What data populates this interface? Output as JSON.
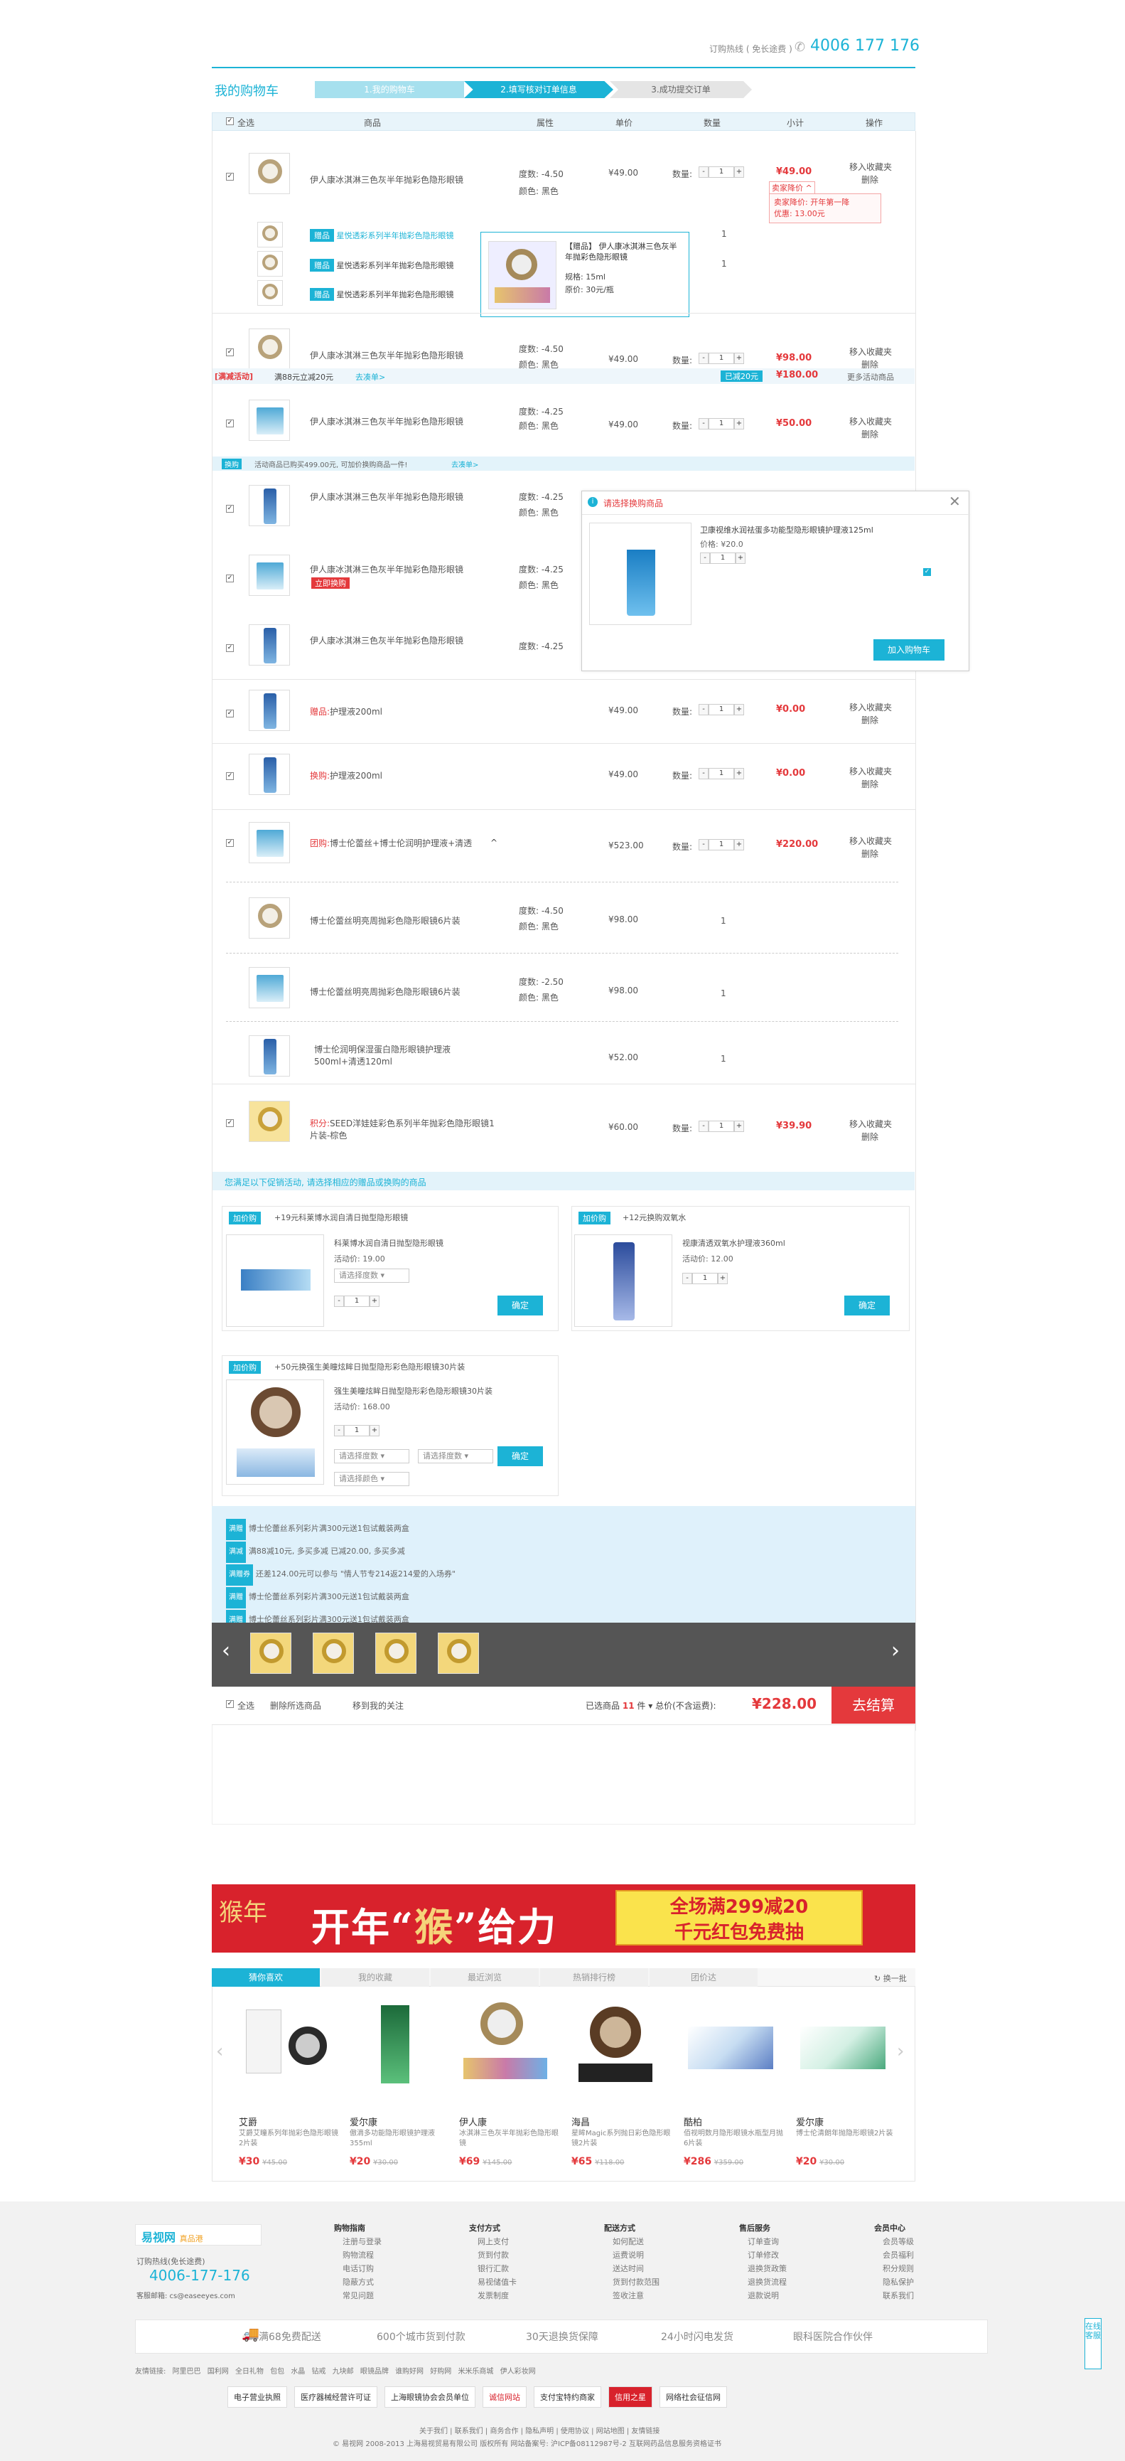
{
  "header": {
    "hotline_label": "订购热线 ( 免长途费 )",
    "hotline_number": "4006 177 176"
  },
  "steps": {
    "title": "我的购物车",
    "step1": "1.我的购物车",
    "step2": "2.填写核对订单信息",
    "step3": "3.成功提交订单"
  },
  "table_head": {
    "select_all": "全选",
    "product": "商品",
    "attr": "属性",
    "unit_price": "单价",
    "quantity": "数量",
    "subtotal": "小计",
    "action": "操作"
  },
  "common": {
    "qty_label": "数量:",
    "degree_prefix": "度数:",
    "color_label": "颜色: 黑色",
    "move_fav": "移入收藏夹",
    "delete": "删除",
    "product_name": "伊人康冰淇淋三色灰半年抛彩色隐形眼镜"
  },
  "row1": {
    "degree": "度数: -4.50",
    "price": "¥49.00",
    "qty": "1",
    "subtotal": "¥49.00",
    "price_drop": "卖家降价",
    "tip_line1": "卖家降价: 开年第一降",
    "tip_line2": "优惠: 13.00元"
  },
  "gifts": {
    "tag": "赠品",
    "name": "星悦透彩系列半年抛彩色隐形眼镜",
    "qty": "1",
    "count_x": "×"
  },
  "popup": {
    "title": "【赠品】 伊人康冰淇淋三色灰半年抛彩色隐形眼镜",
    "spec": "规格: 15ml",
    "orig": "原价: 30元/瓶"
  },
  "row2": {
    "degree": "度数: -4.50",
    "price": "¥49.00",
    "qty": "1",
    "subtotal": "¥98.00"
  },
  "promo_bar": {
    "tag": "[满减活动]",
    "text": "满88元立减20元",
    "link": "去凑单>",
    "saved": "已减20元",
    "total": "¥180.00",
    "more": "更多活动商品"
  },
  "row3": {
    "degree": "度数: -4.25",
    "price": "¥49.00",
    "qty": "1",
    "subtotal": "¥50.00"
  },
  "exchange_bar": {
    "tag": "换购",
    "text": "活动商品已购买499.00元, 可加价换购商品一件!",
    "link": "去凑单>"
  },
  "row4": {
    "degree": "度数: -4.25"
  },
  "row5": {
    "degree": "度数: -4.25",
    "badge": "立即换购"
  },
  "row6": {
    "degree": "度数: -4.25"
  },
  "swap_popup": {
    "title": "请选择换购商品",
    "name": "卫康视维水润祛蛋多功能型隐形眼镜护理液125ml",
    "price": "价格: ¥20.0",
    "qty": "1",
    "button": "加入购物车"
  },
  "row7": {
    "prefix": "赠品:",
    "name": "护理液200ml",
    "price": "¥49.00",
    "qty": "1",
    "subtotal": "¥0.00"
  },
  "row8": {
    "prefix": "换购:",
    "name": "护理液200ml",
    "price": "¥49.00",
    "qty": "1",
    "subtotal": "¥0.00"
  },
  "row9": {
    "prefix": "团购:",
    "name": "博士伦蕾丝+博士伦润明护理液+清透",
    "price": "¥523.00",
    "qty": "1",
    "subtotal": "¥220.00"
  },
  "bundle": [
    {
      "name": "博士伦蕾丝明亮周抛彩色隐形眼镜6片装",
      "degree": "度数: -4.50",
      "color": "颜色: 黑色",
      "price": "¥98.00",
      "qty": "1"
    },
    {
      "name": "博士伦蕾丝明亮周抛彩色隐形眼镜6片装",
      "degree": "度数: -2.50",
      "color": "颜色: 黑色",
      "price": "¥98.00",
      "qty": "1"
    },
    {
      "name": "博士伦润明保湿蛋白隐形眼镜护理液500ml+清透120ml",
      "degree": "",
      "color": "",
      "price": "¥52.00",
      "qty": "1"
    }
  ],
  "row10": {
    "prefix": "积分:",
    "name": "SEED洋娃娃彩色系列半年抛彩色隐形眼镜1片装-棕色",
    "price": "¥60.00",
    "qty": "1",
    "subtotal": "¥39.90"
  },
  "addon_title": "您满足以下促销活动, 请选择相应的赠品或换购的商品",
  "addon": [
    {
      "tag": "加价购",
      "title": "+19元科莱博水润自清日抛型隐形眼镜",
      "name": "科莱博水润自清日抛型隐形眼镜",
      "price": "活动价: 19.00",
      "select1": "请选择度数",
      "qty": "1",
      "btn": "确定"
    },
    {
      "tag": "加价购",
      "title": "+12元换购双氧水",
      "name": "视康清透双氧水护理液360ml",
      "price": "活动价: 12.00",
      "qty": "1",
      "btn": "确定"
    },
    {
      "tag": "加价购",
      "title": "+50元换强生美瞳炫眸日抛型隐形彩色隐形眼镜30片装",
      "name": "强生美瞳炫眸日抛型隐形彩色隐形眼镜30片装",
      "price": "活动价: 168.00",
      "select1": "请选择度数",
      "select2": "请选择度数",
      "select3": "请选择颜色",
      "qty": "1",
      "btn": "确定"
    }
  ],
  "promos": [
    {
      "tag": "满赠",
      "text": "博士伦蕾丝系列彩片满300元送1包试戴装两盒"
    },
    {
      "tag": "满减",
      "text": "满88减10元, 多买多减  已减20.00, 多买多减"
    },
    {
      "tag": "满赠券",
      "text": "还差124.00元可以参与 \"情人节专214返214爱的入场券\""
    },
    {
      "tag": "满赠",
      "text": "博士伦蕾丝系列彩片满300元送1包试戴装两盒"
    },
    {
      "tag": "满赠",
      "text": "博士伦蕾丝系列彩片满300元送1包试戴装两盒"
    }
  ],
  "checkout": {
    "select_all": "全选",
    "delete_selected": "删除所选商品",
    "move_fav": "移到我的关注",
    "selected_label": "已选商品",
    "selected_count": "11",
    "selected_unit": "件",
    "total_label": "总价(不含运费):",
    "total": "¥228.00",
    "button": "去结算"
  },
  "banner": {
    "logo": "猴年",
    "headline_left": "开年",
    "headline_quote": "猴",
    "headline_right": "给力",
    "box_line1": "全场满299减20",
    "box_line2": "千元红包免费抽"
  },
  "rec_tabs": [
    "猜你喜欢",
    "我的收藏",
    "最近浏览",
    "热销排行榜",
    "团价达"
  ],
  "rec_refresh": "换一批",
  "rec_items": [
    {
      "brand": "艾爵",
      "desc": "艾爵艾瞳系列年抛彩色隐形眼镜2片装",
      "price": "¥30",
      "old": "¥45.00"
    },
    {
      "brand": "爱尔康",
      "desc": "傲滴多功能隐形眼镜护理液355ml",
      "price": "¥20",
      "old": "¥30.00"
    },
    {
      "brand": "伊人康",
      "desc": "冰淇淋三色灰半年抛彩色隐形眼镜",
      "price": "¥69",
      "old": "¥145.00"
    },
    {
      "brand": "海昌",
      "desc": "星眸Magic系列抛日彩色隐形眼镜2片装",
      "price": "¥65",
      "old": "¥118.00"
    },
    {
      "brand": "酷柏",
      "desc": "佰视明数月隐形眼镜水瓶型月抛6片装",
      "price": "¥286",
      "old": "¥359.00"
    },
    {
      "brand": "爱尔康",
      "desc": "博士伦清朗年抛隐形眼镜2片装",
      "price": "¥20",
      "old": "¥30.00"
    }
  ],
  "footer": {
    "logo": "易视网",
    "logo_sub": "真品港",
    "hot_label": "订购热线(免长途费)",
    "hot": "4006-177-176",
    "mail": "客服邮箱: cs@easeeyes.com",
    "cols": [
      {
        "title": "购物指南",
        "items": [
          "注册与登录",
          "购物流程",
          "电话订购",
          "隐蔽方式",
          "常见问题"
        ]
      },
      {
        "title": "支付方式",
        "items": [
          "网上支付",
          "货到付款",
          "银行汇款",
          "易视储值卡",
          "发票制度"
        ]
      },
      {
        "title": "配送方式",
        "items": [
          "如何配送",
          "运费说明",
          "送达时间",
          "货到付款范围",
          "签收注意"
        ]
      },
      {
        "title": "售后服务",
        "items": [
          "订单查询",
          "订单修改",
          "退换货政策",
          "退换货流程",
          "退款说明"
        ]
      },
      {
        "title": "会员中心",
        "items": [
          "会员等级",
          "会员福利",
          "积分规则",
          "隐私保护",
          "联系我们"
        ]
      }
    ],
    "guarantees": [
      "满68免费配送",
      "600个城市货到付款",
      "30天退换货保障",
      "24小时闪电发货",
      "眼科医院合作伙伴"
    ],
    "links_label": "友情链接:",
    "links": [
      "阿里巴巴",
      "国利网",
      "全日礼物",
      "包包",
      "水晶",
      "钻戒",
      "九块邮",
      "眼镜品牌",
      "谁购好网",
      "好购网",
      "米米乐商城",
      "伊人彩妆网"
    ],
    "badges": [
      "电子营业执照",
      "医疗器械经营许可证",
      "上海眼镜协会会员单位",
      "诚信网站",
      "支付宝特约商家",
      "信用之星",
      "网络社会征信网"
    ],
    "bottom1": "关于我们 | 联系我们 | 商务合作 | 隐私声明 | 使用协议 | 网站地图 | 友情链接",
    "bottom2": "© 易视网 2008-2013 上海易视贸易有限公司 版权所有 网站备案号: 沪ICP备08112987号-2 互联网药品信息服务资格证书"
  },
  "side_float": "在线客服"
}
